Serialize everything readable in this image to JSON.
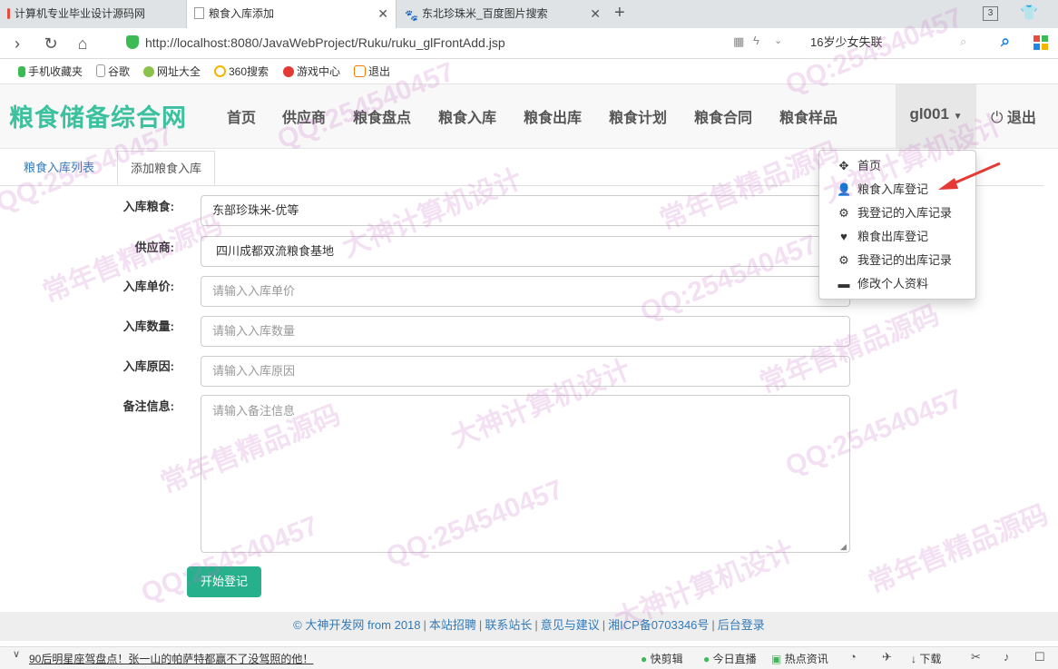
{
  "browser": {
    "tabs": [
      {
        "label": "计算机专业毕业设计源码网"
      },
      {
        "label": "粮食入库添加"
      },
      {
        "label": "东北珍珠米_百度图片搜索"
      }
    ],
    "tab_count": "3",
    "url": "http://localhost:8080/JavaWebProject/Ruku/ruku_glFrontAdd.jsp",
    "search_value": "16岁少女失联",
    "bookmarks": [
      "手机收藏夹",
      "谷歌",
      "网址大全",
      "360搜索",
      "游戏中心",
      "退出"
    ],
    "status_news": "90后明星座驾盘点！张一山的帕萨特都赢不了没驾照的他！",
    "status_items": [
      "快剪辑",
      "今日直播",
      "热点资讯",
      "下载"
    ]
  },
  "site": {
    "brand": "粮食储备综合网",
    "nav": [
      "首页",
      "供应商",
      "粮食盘点",
      "粮食入库",
      "粮食出库",
      "粮食计划",
      "粮食合同",
      "粮食样品"
    ],
    "user": "gl001",
    "logout": "退出",
    "dropdown": [
      {
        "label": "首页",
        "icon": "move-icon"
      },
      {
        "label": "粮食入库登记",
        "icon": "user-icon"
      },
      {
        "label": "我登记的入库记录",
        "icon": "cog-icon"
      },
      {
        "label": "粮食出库登记",
        "icon": "heart-icon"
      },
      {
        "label": "我登记的出库记录",
        "icon": "cog-icon"
      },
      {
        "label": "修改个人资料",
        "icon": "card-icon"
      }
    ]
  },
  "tabs": {
    "list": "粮食入库列表",
    "add": "添加粮食入库"
  },
  "form": {
    "grain_label": "入库粮食:",
    "grain_value": "东部珍珠米-优等",
    "supplier_label": "供应商:",
    "supplier_value": "四川成都双流粮食基地",
    "price_label": "入库单价:",
    "price_placeholder": "请输入入库单价",
    "qty_label": "入库数量:",
    "qty_placeholder": "请输入入库数量",
    "reason_label": "入库原因:",
    "reason_placeholder": "请输入入库原因",
    "remark_label": "备注信息:",
    "remark_placeholder": "请输入备注信息",
    "submit": "开始登记"
  },
  "footer": {
    "copyright": "© 大神开发网 from 2018",
    "links": [
      "本站招聘",
      "联系站长",
      "意见与建议",
      "湘ICP备0703346号",
      "后台登录"
    ]
  },
  "watermarks": [
    "QQ:254540457",
    "大神计算机设计",
    "常年售精品源码"
  ],
  "colors": {
    "brand": "#3cc19f",
    "button": "#26b08b",
    "link": "#337ab7",
    "annotation_arrow": "#e53935"
  }
}
